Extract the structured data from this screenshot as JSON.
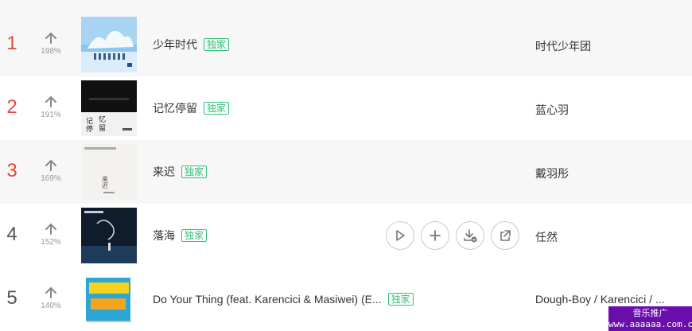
{
  "rows": [
    {
      "rank": "1",
      "trend_pct": "198%",
      "title": "少年时代",
      "badge": "独家",
      "artist": "时代少年团"
    },
    {
      "rank": "2",
      "trend_pct": "191%",
      "title": "记忆停留",
      "badge": "独家",
      "artist": "蓝心羽"
    },
    {
      "rank": "3",
      "trend_pct": "169%",
      "title": "来迟",
      "badge": "独家",
      "artist": "戴羽彤"
    },
    {
      "rank": "4",
      "trend_pct": "152%",
      "title": "落海",
      "badge": "独家",
      "artist": "任然"
    },
    {
      "rank": "5",
      "trend_pct": "140%",
      "title": "Do Your Thing (feat. Karencici & Masiwei) (E...",
      "badge": "独家",
      "artist": "Dough-Boy / Karencici / ..."
    }
  ],
  "covers": {
    "row2_text_a": "记",
    "row2_text_b": "忆",
    "row2_text_c": "停",
    "row2_text_d": "留",
    "row3_text": "来迟"
  },
  "watermark": {
    "line1": "音乐推广",
    "line2": "www.aaaaaa.com.cn"
  },
  "colors": {
    "hot_rank": "#e8473b",
    "badge": "#31c27c",
    "watermark_bg": "#6a0dad"
  },
  "icons": {
    "trend": "arrow-up-icon",
    "play": "play-icon",
    "add": "plus-icon",
    "download": "download-icon",
    "share": "share-icon"
  }
}
